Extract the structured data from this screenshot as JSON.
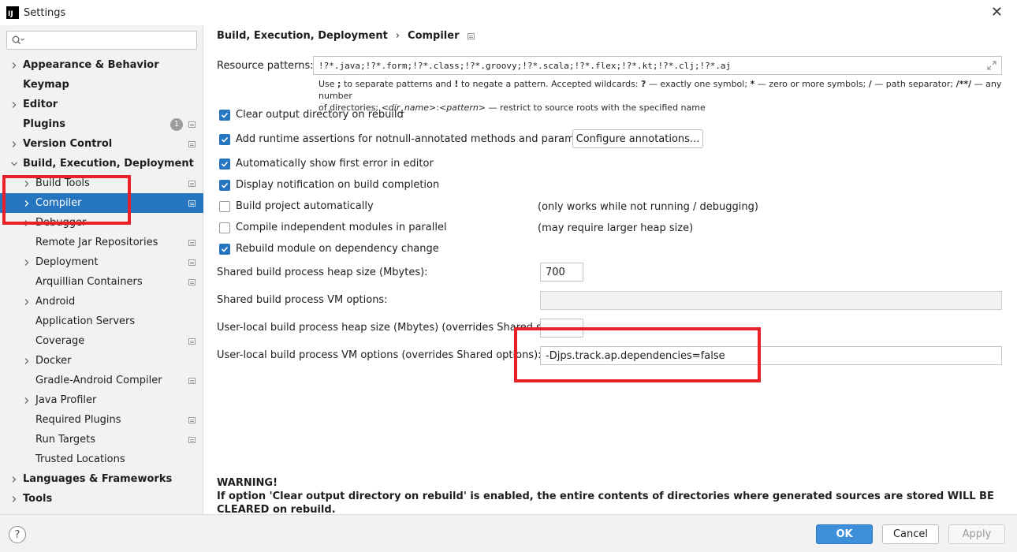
{
  "window": {
    "title": "Settings",
    "app_icon": "IJ"
  },
  "search": {
    "placeholder": "",
    "value": ""
  },
  "sidebar": {
    "items": [
      {
        "label": "Appearance & Behavior",
        "level": 0,
        "bold": true,
        "expandable": true,
        "has_icon": false
      },
      {
        "label": "Keymap",
        "level": 0,
        "bold": true,
        "expandable": false,
        "has_icon": false
      },
      {
        "label": "Editor",
        "level": 0,
        "bold": true,
        "expandable": true,
        "has_icon": false
      },
      {
        "label": "Plugins",
        "level": 0,
        "bold": true,
        "expandable": false,
        "has_icon": true,
        "badge": "1"
      },
      {
        "label": "Version Control",
        "level": 0,
        "bold": true,
        "expandable": true,
        "has_icon": true
      },
      {
        "label": "Build, Execution, Deployment",
        "level": 0,
        "bold": true,
        "expandable": true,
        "expanded": true,
        "has_icon": false
      },
      {
        "label": "Build Tools",
        "level": 1,
        "bold": false,
        "expandable": true,
        "has_icon": true
      },
      {
        "label": "Compiler",
        "level": 1,
        "bold": false,
        "expandable": true,
        "has_icon": true,
        "selected": true
      },
      {
        "label": "Debugger",
        "level": 1,
        "bold": false,
        "expandable": true,
        "has_icon": false
      },
      {
        "label": "Remote Jar Repositories",
        "level": 1,
        "bold": false,
        "expandable": false,
        "has_icon": true
      },
      {
        "label": "Deployment",
        "level": 1,
        "bold": false,
        "expandable": true,
        "has_icon": true
      },
      {
        "label": "Arquillian Containers",
        "level": 1,
        "bold": false,
        "expandable": false,
        "has_icon": true
      },
      {
        "label": "Android",
        "level": 1,
        "bold": false,
        "expandable": true,
        "has_icon": false
      },
      {
        "label": "Application Servers",
        "level": 1,
        "bold": false,
        "expandable": false,
        "has_icon": false
      },
      {
        "label": "Coverage",
        "level": 1,
        "bold": false,
        "expandable": false,
        "has_icon": true
      },
      {
        "label": "Docker",
        "level": 1,
        "bold": false,
        "expandable": true,
        "has_icon": false
      },
      {
        "label": "Gradle-Android Compiler",
        "level": 1,
        "bold": false,
        "expandable": false,
        "has_icon": true
      },
      {
        "label": "Java Profiler",
        "level": 1,
        "bold": false,
        "expandable": true,
        "has_icon": false
      },
      {
        "label": "Required Plugins",
        "level": 1,
        "bold": false,
        "expandable": false,
        "has_icon": true
      },
      {
        "label": "Run Targets",
        "level": 1,
        "bold": false,
        "expandable": false,
        "has_icon": true
      },
      {
        "label": "Trusted Locations",
        "level": 1,
        "bold": false,
        "expandable": false,
        "has_icon": false
      },
      {
        "label": "Languages & Frameworks",
        "level": 0,
        "bold": true,
        "expandable": true,
        "has_icon": false
      },
      {
        "label": "Tools",
        "level": 0,
        "bold": true,
        "expandable": true,
        "has_icon": false
      }
    ]
  },
  "breadcrumb": {
    "parent": "Build, Execution, Deployment",
    "separator": "›",
    "current": "Compiler"
  },
  "resource_patterns": {
    "label": "Resource patterns:",
    "value": "!?*.java;!?*.form;!?*.class;!?*.groovy;!?*.scala;!?*.flex;!?*.kt;!?*.clj;!?*.aj"
  },
  "hint": {
    "p1": "Use ",
    "b1": ";",
    "p2": " to separate patterns and ",
    "b2": "!",
    "p3": " to negate a pattern. Accepted wildcards: ",
    "b3": "?",
    "p4": " — exactly one symbol; ",
    "b4": "*",
    "p5": " — zero or more symbols; ",
    "b5": "/",
    "p6": " — path separator; ",
    "b6": "/**/",
    "p7": " — any number",
    "p8": "of directories; ",
    "i1": "<dir_name>",
    "p9": ":",
    "i2": "<pattern>",
    "p10": " — restrict to source roots with the specified name"
  },
  "checkboxes": [
    {
      "label": "Clear output directory on rebuild",
      "checked": true
    },
    {
      "label": "Add runtime assertions for notnull-annotated methods and parameters",
      "checked": true
    },
    {
      "label": "Automatically show first error in editor",
      "checked": true
    },
    {
      "label": "Display notification on build completion",
      "checked": true
    },
    {
      "label": "Build project automatically",
      "checked": false,
      "note": "(only works while not running / debugging)"
    },
    {
      "label": "Compile independent modules in parallel",
      "checked": false,
      "note": "(may require larger heap size)"
    },
    {
      "label": "Rebuild module on dependency change",
      "checked": true
    }
  ],
  "configure_button": "Configure annotations...",
  "fields": {
    "shared_heap": {
      "label": "Shared build process heap size (Mbytes):",
      "value": "700"
    },
    "shared_vm": {
      "label": "Shared build process VM options:",
      "value": ""
    },
    "local_heap": {
      "label": "User-local build process heap size (Mbytes) (overrides Shared size):",
      "value": ""
    },
    "local_vm": {
      "label": "User-local build process VM options (overrides Shared options):",
      "value": "-Djps.track.ap.dependencies=false"
    }
  },
  "warning": {
    "title": "WARNING!",
    "text": "If option 'Clear output directory on rebuild' is enabled, the entire contents of directories where generated sources are stored WILL BE CLEARED on rebuild."
  },
  "footer": {
    "help": "?",
    "ok": "OK",
    "cancel": "Cancel",
    "apply": "Apply"
  },
  "colors": {
    "accent": "#2675bf",
    "highlight_box": "#e8202a",
    "ok_button": "#3d8fd9"
  }
}
